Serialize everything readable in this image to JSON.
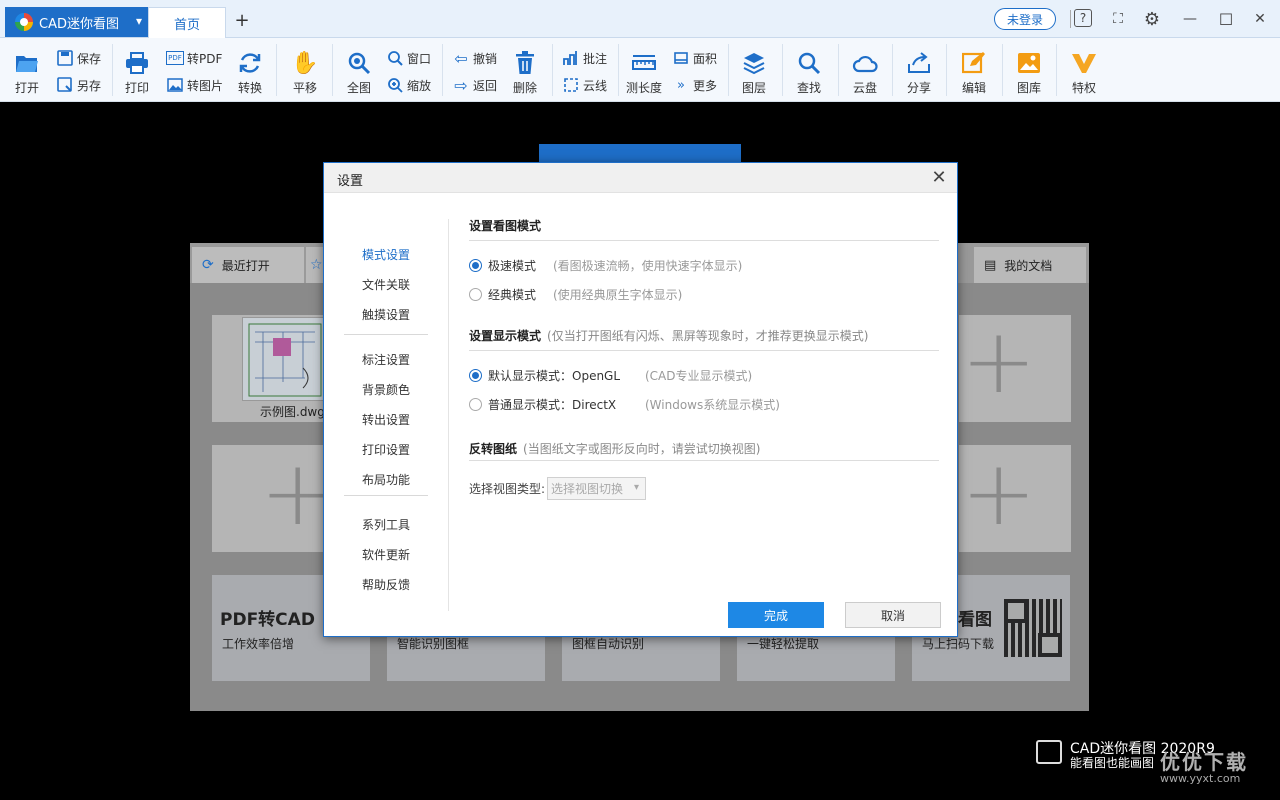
{
  "titlebar": {
    "app_name": "CAD迷你看图",
    "home_tab": "首页",
    "new_tab": "+",
    "login": "未登录",
    "help_icon": "?",
    "fullscreen_icon": "⛶",
    "settings_icon": "⚙",
    "minimize_icon": "—",
    "maximize_icon": "☐",
    "close_icon": "✕"
  },
  "toolbar": {
    "open": "打开",
    "save": "保存",
    "save_as": "另存",
    "print": "打印",
    "to_pdf": "转PDF",
    "to_image": "转图片",
    "convert": "转换",
    "pan": "平移",
    "full_view": "全图",
    "window": "窗口",
    "zoom": "缩放",
    "undo": "撤销",
    "back": "返回",
    "delete": "删除",
    "annotate": "批注",
    "cloud_line": "云线",
    "measure_length": "测长度",
    "area": "面积",
    "more": "更多",
    "layers": "图层",
    "find": "查找",
    "cloud_disk": "云盘",
    "share": "分享",
    "edit": "编辑",
    "library": "图库",
    "privilege": "特权"
  },
  "home": {
    "tab_recent": "最近打开",
    "tab_my_docs": "我的文档",
    "recent_file": "示例图.dwg",
    "banners": [
      {
        "title": "PDF转CAD",
        "sub": "工作效率倍增"
      },
      {
        "title": "",
        "sub": "智能识别图框"
      },
      {
        "title": "",
        "sub": "图框自动识别"
      },
      {
        "title": "",
        "sub": "一键轻松提取"
      },
      {
        "title": "看图",
        "sub": "马上扫码下载"
      }
    ]
  },
  "brand": {
    "name": "CAD迷你看图  2020R9",
    "sub": "能看图也能画图",
    "site_mark": "优优下载",
    "site_url": "www.yyxt.com"
  },
  "dialog": {
    "title": "设置",
    "close": "✕",
    "nav": [
      "模式设置",
      "文件关联",
      "触摸设置",
      "标注设置",
      "背景颜色",
      "转出设置",
      "打印设置",
      "布局功能",
      "系列工具",
      "软件更新",
      "帮助反馈"
    ],
    "section_view_mode": "设置看图模式",
    "radio_fast": "极速模式",
    "radio_fast_hint": "(看图极速流畅，使用快速字体显示)",
    "radio_classic": "经典模式",
    "radio_classic_hint": "(使用经典原生字体显示)",
    "section_display_mode": "设置显示模式",
    "section_display_note": "(仅当打开图纸有闪烁、黑屏等现象时，才推荐更换显示模式)",
    "radio_opengl": "默认显示模式：OpenGL",
    "radio_opengl_hint": "(CAD专业显示模式)",
    "radio_directx": "普通显示模式：DirectX",
    "radio_directx_hint": "(Windows系统显示模式)",
    "section_invert": "反转图纸",
    "section_invert_note": "(当图纸文字或图形反向时，请尝试切换视图)",
    "select_label": "选择视图类型:",
    "select_value": "选择视图切换",
    "ok": "完成",
    "cancel": "取消"
  }
}
